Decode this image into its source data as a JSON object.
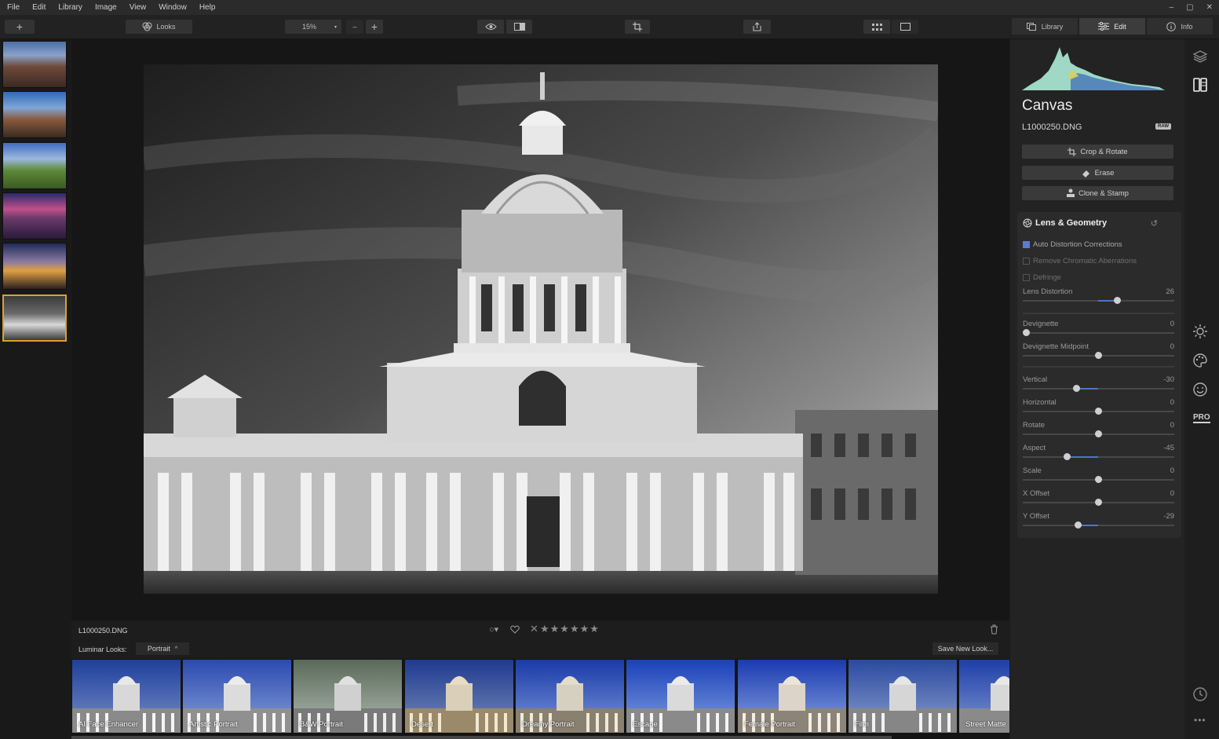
{
  "menu": [
    "File",
    "Edit",
    "Library",
    "Image",
    "View",
    "Window",
    "Help"
  ],
  "window_controls": [
    "–",
    "▢",
    "✕"
  ],
  "toolbar": {
    "add_label": "+",
    "looks_label": "Looks",
    "zoom_value": "15%",
    "zoom_out": "–",
    "zoom_in": "+"
  },
  "tabs": [
    {
      "label": "Library",
      "icon": "library-icon"
    },
    {
      "label": "Edit",
      "icon": "sliders-icon"
    },
    {
      "label": "Info",
      "icon": "info-icon"
    }
  ],
  "panel": {
    "title": "Canvas",
    "filename": "L1000250.DNG",
    "raw_badge": "RAW",
    "buttons": [
      "Crop & Rotate",
      "Erase",
      "Clone & Stamp"
    ],
    "section": {
      "title": "Lens & Geometry",
      "checkboxes": [
        {
          "label": "Auto Distortion Corrections",
          "checked": true
        },
        {
          "label": "Remove Chromatic Aberrations",
          "checked": false
        },
        {
          "label": "Defringe",
          "checked": false
        }
      ],
      "sliders": [
        {
          "label": "Lens Distortion",
          "value": "26",
          "pos": 0.63,
          "min": -100,
          "max": 100
        },
        {
          "label": "Devignette",
          "value": "0",
          "pos": 0.0,
          "min": 0,
          "max": 100
        },
        {
          "label": "Devignette Midpoint",
          "value": "0",
          "pos": 0.5,
          "min": -100,
          "max": 100
        },
        {
          "label": "Vertical",
          "value": "-30",
          "pos": 0.35,
          "min": -100,
          "max": 100
        },
        {
          "label": "Horizontal",
          "value": "0",
          "pos": 0.5,
          "min": -100,
          "max": 100
        },
        {
          "label": "Rotate",
          "value": "0",
          "pos": 0.5,
          "min": -100,
          "max": 100
        },
        {
          "label": "Aspect",
          "value": "-45",
          "pos": 0.28,
          "min": -100,
          "max": 100
        },
        {
          "label": "Scale",
          "value": "0",
          "pos": 0.5,
          "min": -100,
          "max": 100
        },
        {
          "label": "X Offset",
          "value": "0",
          "pos": 0.5,
          "min": -100,
          "max": 100
        },
        {
          "label": "Y Offset",
          "value": "-29",
          "pos": 0.36,
          "min": -100,
          "max": 100
        }
      ]
    }
  },
  "infobar": {
    "filename": "L1000250.DNG",
    "rating_stars": "★★★★★★"
  },
  "looks_bar": {
    "label": "Luminar Looks:",
    "category": "Portrait",
    "save_label": "Save New Look..."
  },
  "looks": [
    "AI Face Enhancer",
    "Artistic Portrait",
    "B&W Portrait",
    "Desert",
    "Dreamy Portrait",
    "Escape",
    "Female Portrait",
    "Film",
    "Street Matte"
  ],
  "sidebar_icons": [
    "layers-icon",
    "canvas-icon",
    "sun-icon",
    "palette-icon",
    "face-icon",
    "pro-icon",
    "history-icon",
    "more-icon"
  ],
  "sidebar_pro_label": "PRO"
}
